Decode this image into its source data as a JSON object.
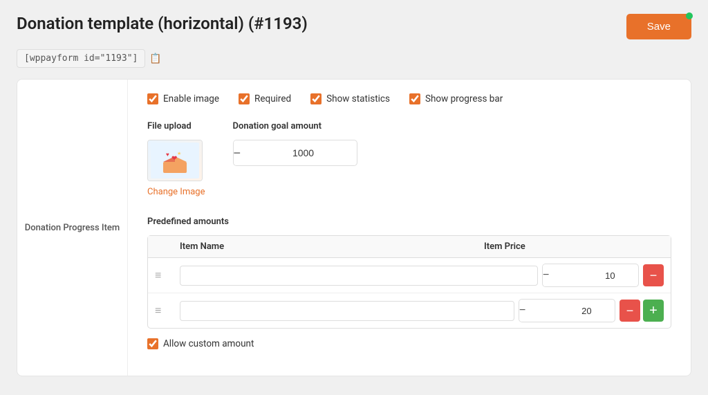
{
  "page": {
    "title": "Donation template (horizontal) (#1193)",
    "shortcode": "[wppayform id=\"1193\"]",
    "save_label": "Save",
    "green_dot": true
  },
  "checkboxes": {
    "enable_image": {
      "label": "Enable image",
      "checked": true
    },
    "required": {
      "label": "Required",
      "checked": true
    },
    "show_statistics": {
      "label": "Show statistics",
      "checked": true
    },
    "show_progress_bar": {
      "label": "Show progress bar",
      "checked": true
    }
  },
  "file_upload": {
    "label": "File upload",
    "change_image_label": "Change Image"
  },
  "donation_goal": {
    "label": "Donation goal amount",
    "value": "1000"
  },
  "predefined_amounts": {
    "label": "Predefined amounts",
    "columns": {
      "item_name": "Item Name",
      "item_price": "Item Price"
    },
    "rows": [
      {
        "name": "",
        "price": "10"
      },
      {
        "name": "",
        "price": "20"
      }
    ]
  },
  "allow_custom": {
    "label": "Allow custom amount",
    "checked": true
  },
  "sidebar": {
    "label": "Donation Progress Item"
  },
  "icons": {
    "copy": "📋",
    "drag": "≡",
    "minus": "−",
    "plus": "+"
  }
}
